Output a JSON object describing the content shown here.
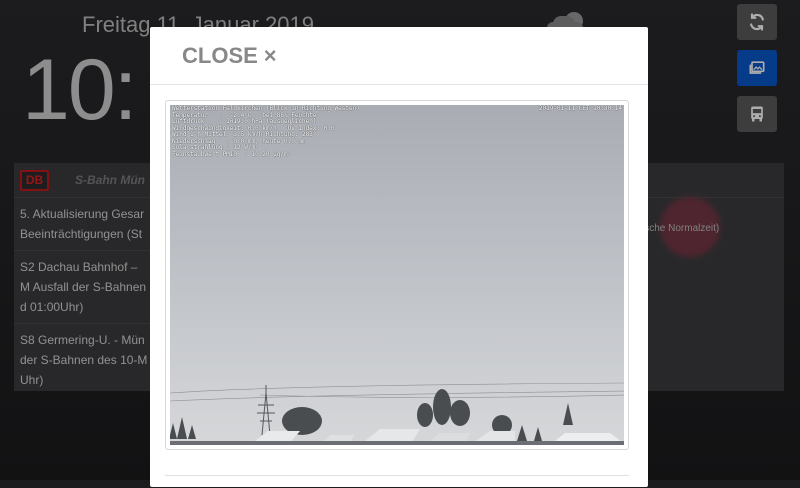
{
  "dashboard": {
    "date": "Freitag 11. Januar 2019",
    "time": "10:",
    "weather_icon": "cloud-sun-icon",
    "buttons": [
      {
        "name": "refresh-button",
        "icon": "refresh-icon"
      },
      {
        "name": "gallery-button",
        "icon": "images-icon",
        "color": "#0a58ca"
      },
      {
        "name": "bus-button",
        "icon": "bus-icon"
      }
    ],
    "db_panel": {
      "logo": "DB",
      "title": "S-Bahn Mün",
      "right_note": "ische Normalzeit)",
      "items": [
        {
          "text": "5. Aktualisierung Gesar Beeinträchtigungen (St"
        },
        {
          "text": "S2 Dachau Bahnhof – M Ausfall der S-Bahnen d 01:00Uhr)"
        },
        {
          "text": "S8 Germering-U. - Mün der S-Bahnen des 10-M Uhr)"
        }
      ]
    }
  },
  "modal": {
    "close_label": "CLOSE",
    "close_symbol": "×",
    "camera": {
      "overlay_title": "Wetterstation Feldkirchen (Blick in Richtung Westen)",
      "overlay_lines": [
        "Temperatur   :  -2.4°C   bei 88% Feuchte",
        "Luftdruck    : 1019.0 hPa (ausgeglichen)",
        "Windgeschwindigkeit: 0.0 km/h   UV Index: 0.0",
        "Wind 1-h Mittel: 3.5 km/h Richtung: 283°",
        "Niederschlag   : 0.0 mm, heute 0.0 mm",
        "Solarstrahlung : 12 W/m²",
        "Feinstaubwert PM10  : 10.20 µg/m³"
      ],
      "timestamp": "2019-01-11 CET 10:30:14"
    }
  }
}
